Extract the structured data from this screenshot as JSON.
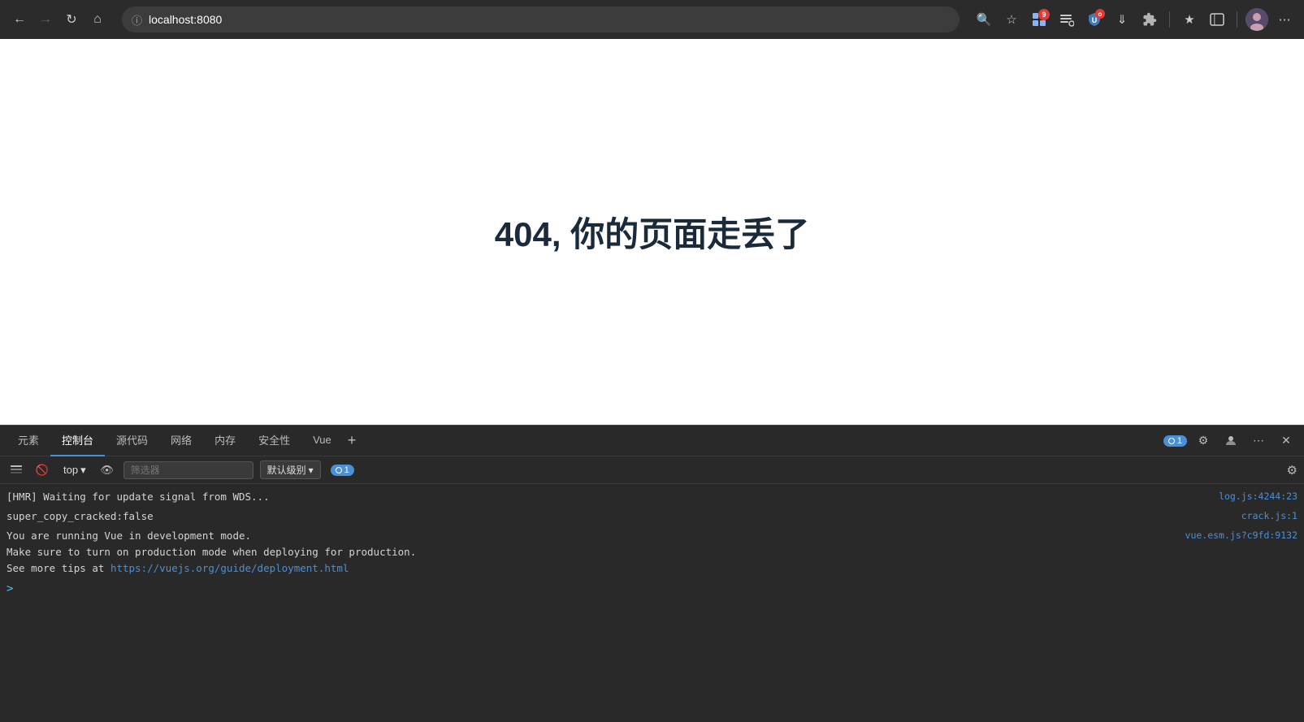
{
  "browser": {
    "url": "localhost:8080",
    "nav": {
      "back": "←",
      "forward": "→",
      "reload": "↻",
      "home": "⌂"
    },
    "toolbar_icons": [
      {
        "name": "search",
        "symbol": "🔍"
      },
      {
        "name": "star",
        "symbol": "☆"
      },
      {
        "name": "extensions",
        "symbol": "⬛",
        "badge": "9"
      },
      {
        "name": "refresh-ext",
        "symbol": "⟳"
      },
      {
        "name": "shield",
        "symbol": "🛡"
      },
      {
        "name": "uo-icon",
        "symbol": "U",
        "badge_text": "o"
      },
      {
        "name": "download",
        "symbol": "⬇"
      },
      {
        "name": "puzzle",
        "symbol": "🧩"
      },
      {
        "name": "favorites",
        "symbol": "★"
      },
      {
        "name": "collections",
        "symbol": "⊞"
      },
      {
        "name": "more",
        "symbol": "⋯"
      }
    ]
  },
  "page": {
    "error_title": "404, 你的页面走丢了"
  },
  "devtools": {
    "tabs": [
      {
        "label": "元素",
        "active": false
      },
      {
        "label": "控制台",
        "active": true
      },
      {
        "label": "源代码",
        "active": false
      },
      {
        "label": "网络",
        "active": false
      },
      {
        "label": "内存",
        "active": false
      },
      {
        "label": "安全性",
        "active": false
      },
      {
        "label": "Vue",
        "active": false
      }
    ],
    "actions": {
      "info_count": "1",
      "settings_label": "⚙",
      "user_label": "👤",
      "more_label": "⋯",
      "close_label": "✕"
    },
    "console": {
      "top_label": "top",
      "filter_placeholder": "筛选器",
      "level_label": "默认级别",
      "info_count": "1",
      "lines": [
        {
          "text": "[HMR] Waiting for update signal from WDS...",
          "file": "log.js:4244:23"
        },
        {
          "text": "super_copy_cracked:false",
          "file": "crack.js:1"
        },
        {
          "text_parts": [
            {
              "text": "You are running Vue in development mode.\nMake sure to turn on production mode when deploying for production.\nSee more tips at "
            },
            {
              "text": "https://vuejs.org/guide/deployment.html",
              "link": true
            }
          ],
          "file": "vue.esm.js?c9fd:9132"
        }
      ],
      "prompt": ">"
    }
  }
}
